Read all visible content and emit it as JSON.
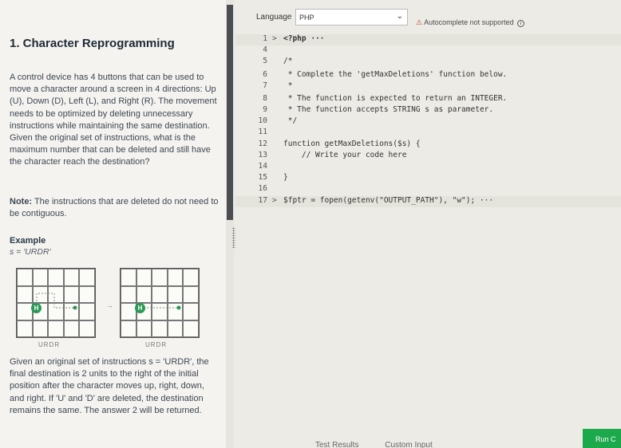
{
  "problem": {
    "title": "1. Character Reprogramming",
    "description": "A control device has 4 buttons that can be used to move a character around a screen in 4 directions: Up (U), Down (D), Left (L), and Right (R). The movement needs to be optimized by deleting unnecessary instructions while maintaining the same destination. Given the original set of instructions, what is the maximum number that can be deleted and still have the character reach the destination?",
    "note_label": "Note:",
    "note_text": " The instructions that are deleted do not need to be contiguous.",
    "example_label": "Example",
    "example_s": "s = 'URDR'",
    "grid_caption_1": "URDR",
    "grid_caption_2": "URDR",
    "badge_letter": "H",
    "explanation": "Given an original set of instructions s = 'URDR', the final destination is 2 units to the right of the initial position after the character moves up, right, down, and right. If 'U' and 'D' are deleted, the destination remains the same. The answer 2 will be returned."
  },
  "editor": {
    "language_label": "Language",
    "language_value": "PHP",
    "autocomplete_text": "Autocomplete not supported",
    "code_lines": [
      {
        "num": "1",
        "fold": ">",
        "text": "<?php ···"
      },
      {
        "num": "4",
        "fold": "",
        "text": ""
      },
      {
        "num": "5",
        "fold": "",
        "text": "/*"
      },
      {
        "num": "6",
        "fold": "",
        "text": " * Complete the 'getMaxDeletions' function below."
      },
      {
        "num": "7",
        "fold": "",
        "text": " *"
      },
      {
        "num": "8",
        "fold": "",
        "text": " * The function is expected to return an INTEGER."
      },
      {
        "num": "9",
        "fold": "",
        "text": " * The function accepts STRING s as parameter."
      },
      {
        "num": "10",
        "fold": "",
        "text": " */"
      },
      {
        "num": "11",
        "fold": "",
        "text": ""
      },
      {
        "num": "12",
        "fold": "",
        "text": "function getMaxDeletions($s) {"
      },
      {
        "num": "13",
        "fold": "",
        "text": "    // Write your code here"
      },
      {
        "num": "14",
        "fold": "",
        "text": ""
      },
      {
        "num": "15",
        "fold": "",
        "text": "}"
      },
      {
        "num": "16",
        "fold": "",
        "text": ""
      },
      {
        "num": "17",
        "fold": ">",
        "text": "$fptr = fopen(getenv(\"OUTPUT_PATH\"), \"w\"); ···"
      }
    ]
  },
  "footer": {
    "tab_results": "Test Results",
    "tab_custom": "Custom Input",
    "run_label": "Run C"
  },
  "colors": {
    "run_button": "#1ba94c",
    "badge": "#2c9a57",
    "keyword": "#a33333",
    "comment": "#2b4aa3"
  }
}
